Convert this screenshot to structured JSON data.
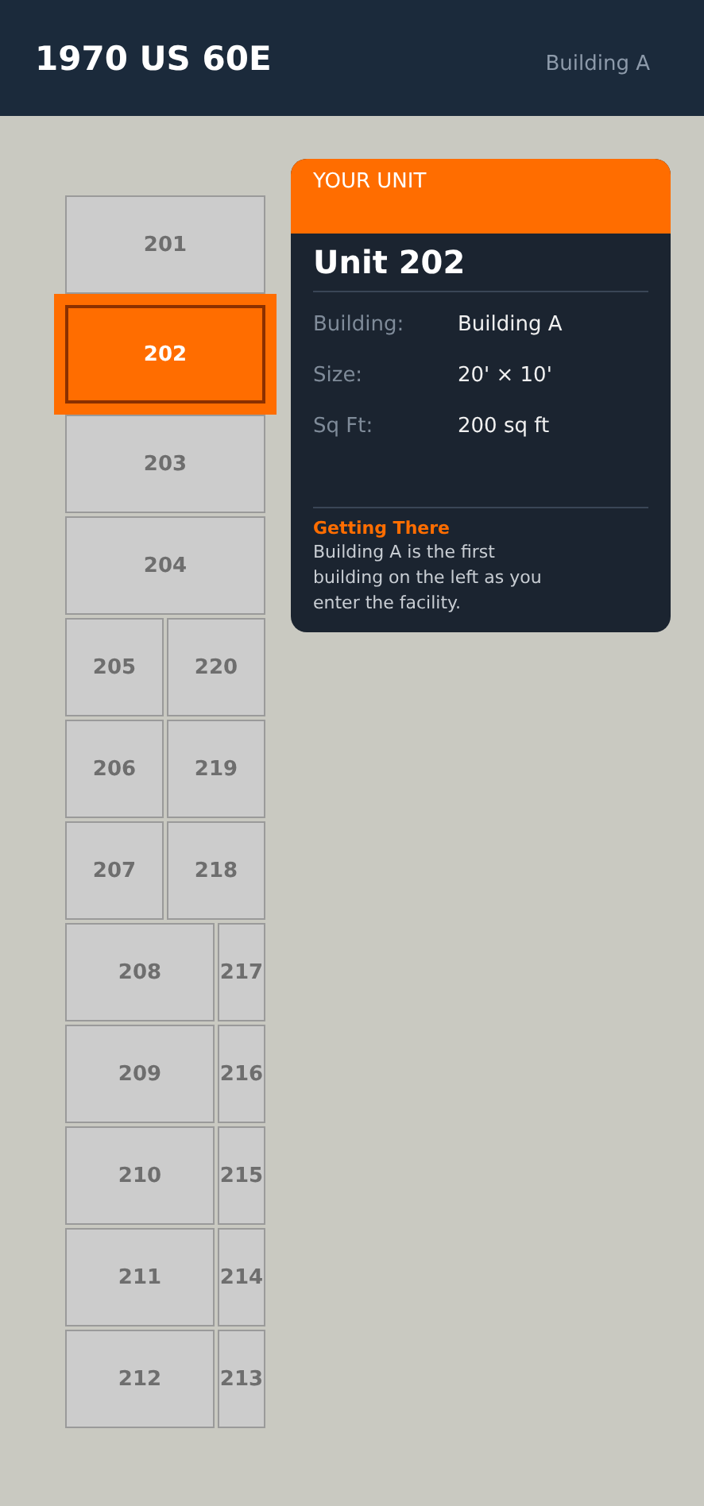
{
  "header": {
    "title": "1970 US 60E",
    "subtitle": "Building A"
  },
  "map": {
    "rows": [
      {
        "kind": "full",
        "units": [
          {
            "label": "201",
            "selected": false
          }
        ]
      },
      {
        "kind": "full",
        "units": [
          {
            "label": "202",
            "selected": true
          }
        ]
      },
      {
        "kind": "full",
        "units": [
          {
            "label": "203",
            "selected": false
          }
        ]
      },
      {
        "kind": "full",
        "units": [
          {
            "label": "204",
            "selected": false
          }
        ]
      },
      {
        "kind": "half",
        "units": [
          {
            "label": "205",
            "selected": false
          },
          {
            "label": "220",
            "selected": false
          }
        ]
      },
      {
        "kind": "half",
        "units": [
          {
            "label": "206",
            "selected": false
          },
          {
            "label": "219",
            "selected": false
          }
        ]
      },
      {
        "kind": "half",
        "units": [
          {
            "label": "207",
            "selected": false
          },
          {
            "label": "218",
            "selected": false
          }
        ]
      },
      {
        "kind": "split",
        "units": [
          {
            "label": "208",
            "selected": false
          },
          {
            "label": "217",
            "selected": false
          }
        ]
      },
      {
        "kind": "split",
        "units": [
          {
            "label": "209",
            "selected": false
          },
          {
            "label": "216",
            "selected": false
          }
        ]
      },
      {
        "kind": "split",
        "units": [
          {
            "label": "210",
            "selected": false
          },
          {
            "label": "215",
            "selected": false
          }
        ]
      },
      {
        "kind": "split",
        "units": [
          {
            "label": "211",
            "selected": false
          },
          {
            "label": "214",
            "selected": false
          }
        ]
      },
      {
        "kind": "split",
        "units": [
          {
            "label": "212",
            "selected": false
          },
          {
            "label": "213",
            "selected": false
          }
        ]
      }
    ]
  },
  "card": {
    "badge": "YOUR UNIT",
    "title": "Unit 202",
    "details": [
      {
        "label": "Building:",
        "value": "Building A"
      },
      {
        "label": "Size:",
        "value": "20' × 10'"
      },
      {
        "label": "Sq Ft:",
        "value": "200 sq ft"
      }
    ],
    "directions": {
      "heading": "Getting There",
      "text": "Building A is the first building on the left as you enter the facility."
    }
  }
}
